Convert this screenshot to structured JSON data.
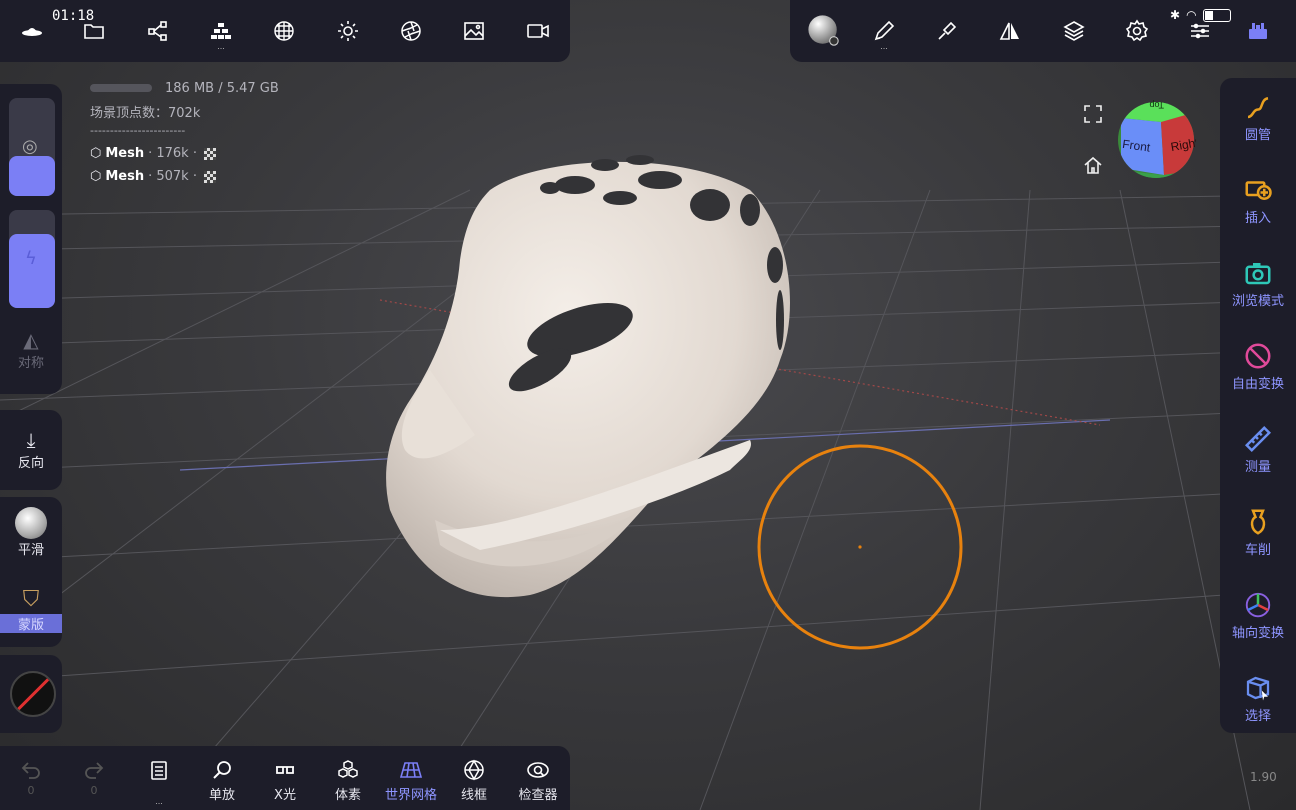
{
  "status": {
    "time": "01:18"
  },
  "top_toolbar": {
    "left_items": [
      {
        "name": "files",
        "icon": "folder-icon"
      },
      {
        "name": "scene",
        "icon": "graph-icon"
      },
      {
        "name": "multires",
        "icon": "pyramid-icon"
      },
      {
        "name": "topology",
        "icon": "sphere-grid-icon"
      },
      {
        "name": "lighting",
        "icon": "sun-icon"
      },
      {
        "name": "material",
        "icon": "aperture-icon"
      },
      {
        "name": "background",
        "icon": "image-icon"
      },
      {
        "name": "record",
        "icon": "video-icon"
      }
    ],
    "right_items": [
      {
        "name": "material-ball",
        "icon": "material-ball-icon"
      },
      {
        "name": "brush",
        "icon": "pen-icon"
      },
      {
        "name": "stroke",
        "icon": "brush-icon"
      },
      {
        "name": "symmetry",
        "icon": "mirror-icon"
      },
      {
        "name": "layers",
        "icon": "layers-icon"
      },
      {
        "name": "settings",
        "icon": "gear-icon"
      },
      {
        "name": "sliders",
        "icon": "sliders-icon"
      },
      {
        "name": "tool-settings",
        "icon": "toolbox-icon"
      }
    ]
  },
  "stats": {
    "memory": "186 MB / 5.47 GB",
    "vertices": "场景顶点数：702k",
    "separator": "------------------------",
    "meshes": [
      {
        "name": "Mesh",
        "count": "· 176k ·"
      },
      {
        "name": "Mesh",
        "count": "· 507k ·"
      }
    ]
  },
  "left_panel": {
    "symmetry_label": "对称",
    "reverse_label": "反向",
    "smooth_label": "平滑",
    "mask_label": "蒙版"
  },
  "right_panel": {
    "tools": [
      {
        "label": "圆管",
        "icon": "tube-icon"
      },
      {
        "label": "插入",
        "icon": "insert-icon"
      },
      {
        "label": "浏览模式",
        "icon": "camera-icon"
      },
      {
        "label": "自由变换",
        "icon": "transform-icon"
      },
      {
        "label": "测量",
        "icon": "ruler-icon"
      },
      {
        "label": "车削",
        "icon": "lathe-icon"
      },
      {
        "label": "轴向变换",
        "icon": "gizmo-icon"
      },
      {
        "label": "选择",
        "icon": "select-box-icon"
      }
    ]
  },
  "bottom_toolbar": {
    "undo_count": "0",
    "redo_count": "0",
    "items": [
      {
        "label": "",
        "icon": "document-icon"
      },
      {
        "label": "单放",
        "icon": "search-icon"
      },
      {
        "label": "X光",
        "icon": "glasses-icon"
      },
      {
        "label": "体素",
        "icon": "voxel-icon"
      },
      {
        "label": "世界网格",
        "icon": "world-grid-icon",
        "active": true
      },
      {
        "label": "线框",
        "icon": "wireframe-icon"
      },
      {
        "label": "检查器",
        "icon": "inspector-icon"
      }
    ]
  },
  "view_cube": {
    "front": "Front",
    "right": "Right",
    "top": "Top"
  },
  "version": "1.90",
  "colors": {
    "accent": "#7b7ff5",
    "panel": "#1d1d29",
    "cursor": "#e8820e",
    "mask": "#f2ece6"
  }
}
